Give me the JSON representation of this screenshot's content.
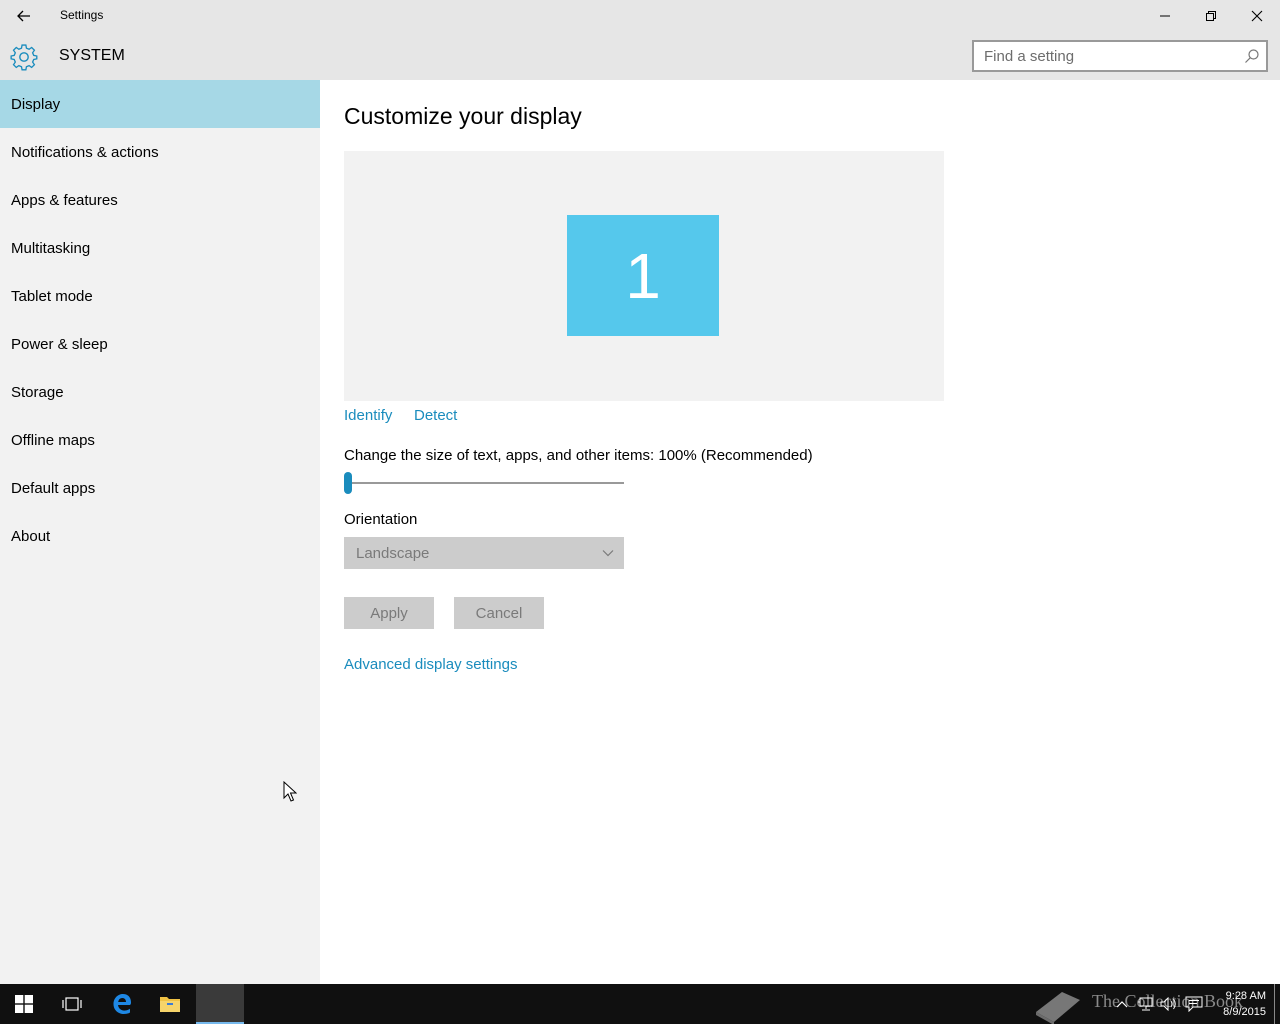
{
  "window": {
    "title": "Settings",
    "minimize_icon": "minimize-icon",
    "maximize_icon": "restore-icon",
    "close_icon": "close-icon"
  },
  "header": {
    "section": "SYSTEM",
    "icon": "gear-icon",
    "search_placeholder": "Find a setting"
  },
  "sidebar": {
    "items": [
      {
        "label": "Display",
        "active": true
      },
      {
        "label": "Notifications & actions"
      },
      {
        "label": "Apps & features"
      },
      {
        "label": "Multitasking"
      },
      {
        "label": "Tablet mode"
      },
      {
        "label": "Power & sleep"
      },
      {
        "label": "Storage"
      },
      {
        "label": "Offline maps"
      },
      {
        "label": "Default apps"
      },
      {
        "label": "About"
      }
    ]
  },
  "main": {
    "title": "Customize your display",
    "monitor_number": "1",
    "identify_link": "Identify",
    "detect_link": "Detect",
    "scale_label": "Change the size of text, apps, and other items: 100% (Recommended)",
    "scale_slider_value": 0,
    "orientation_label": "Orientation",
    "orientation_value": "Landscape",
    "apply_label": "Apply",
    "cancel_label": "Cancel",
    "advanced_link": "Advanced display settings"
  },
  "taskbar": {
    "watermark": "The Collection Book",
    "time": "9:28 AM",
    "date": "8/9/2015"
  },
  "colors": {
    "accent": "#1a8cbd",
    "active_nav": "#a6d8e6",
    "monitor": "#55c8ec"
  }
}
